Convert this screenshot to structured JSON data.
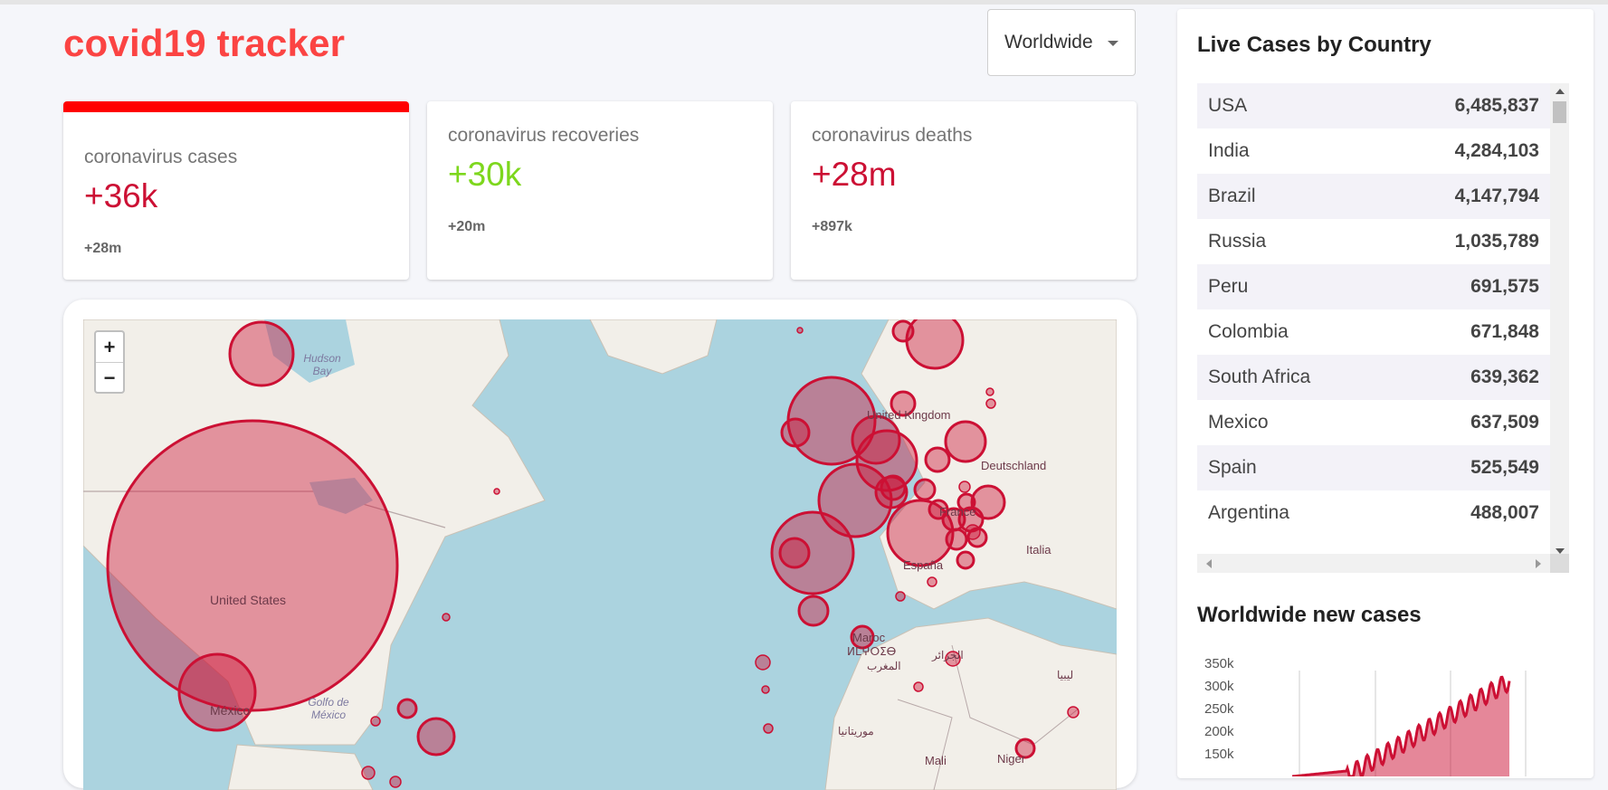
{
  "app": {
    "title": "covid19 tracker"
  },
  "country_select": {
    "selected": "Worldwide"
  },
  "info_boxes": [
    {
      "title": "coronavirus cases",
      "value": "+36k",
      "total": "+28m",
      "value_color": "#cc1034"
    },
    {
      "title": "coronavirus recoveries",
      "value": "+30k",
      "total": "+20m",
      "value_color": "#7dd71d"
    },
    {
      "title": "coronavirus deaths",
      "value": "+28m",
      "total": "+897k",
      "value_color": "#cc1034"
    }
  ],
  "map": {
    "zoom_in": "+",
    "zoom_out": "−",
    "labels": [
      "Hudson Bay",
      "United States",
      "México",
      "Golfo de México",
      "United Kingdom",
      "Deutschland",
      "France",
      "España",
      "Italia",
      "Maroc",
      "ⵍⵎⵖⵔⵉⴱ",
      "المغرب",
      "الجزائر",
      "ليبيا",
      "موريتانيا",
      "Mali",
      "Niger"
    ],
    "circle_color": "#cc1034"
  },
  "sidebar": {
    "table_title": "Live Cases by Country",
    "countries": [
      {
        "country": "USA",
        "cases": "6,485,837"
      },
      {
        "country": "India",
        "cases": "4,284,103"
      },
      {
        "country": "Brazil",
        "cases": "4,147,794"
      },
      {
        "country": "Russia",
        "cases": "1,035,789"
      },
      {
        "country": "Peru",
        "cases": "691,575"
      },
      {
        "country": "Colombia",
        "cases": "671,848"
      },
      {
        "country": "South Africa",
        "cases": "639,362"
      },
      {
        "country": "Mexico",
        "cases": "637,509"
      },
      {
        "country": "Spain",
        "cases": "525,549"
      },
      {
        "country": "Argentina",
        "cases": "488,007"
      }
    ],
    "chart_title": "Worldwide new cases",
    "chart_ticks": [
      "350k",
      "300k",
      "250k",
      "200k",
      "150k"
    ]
  }
}
